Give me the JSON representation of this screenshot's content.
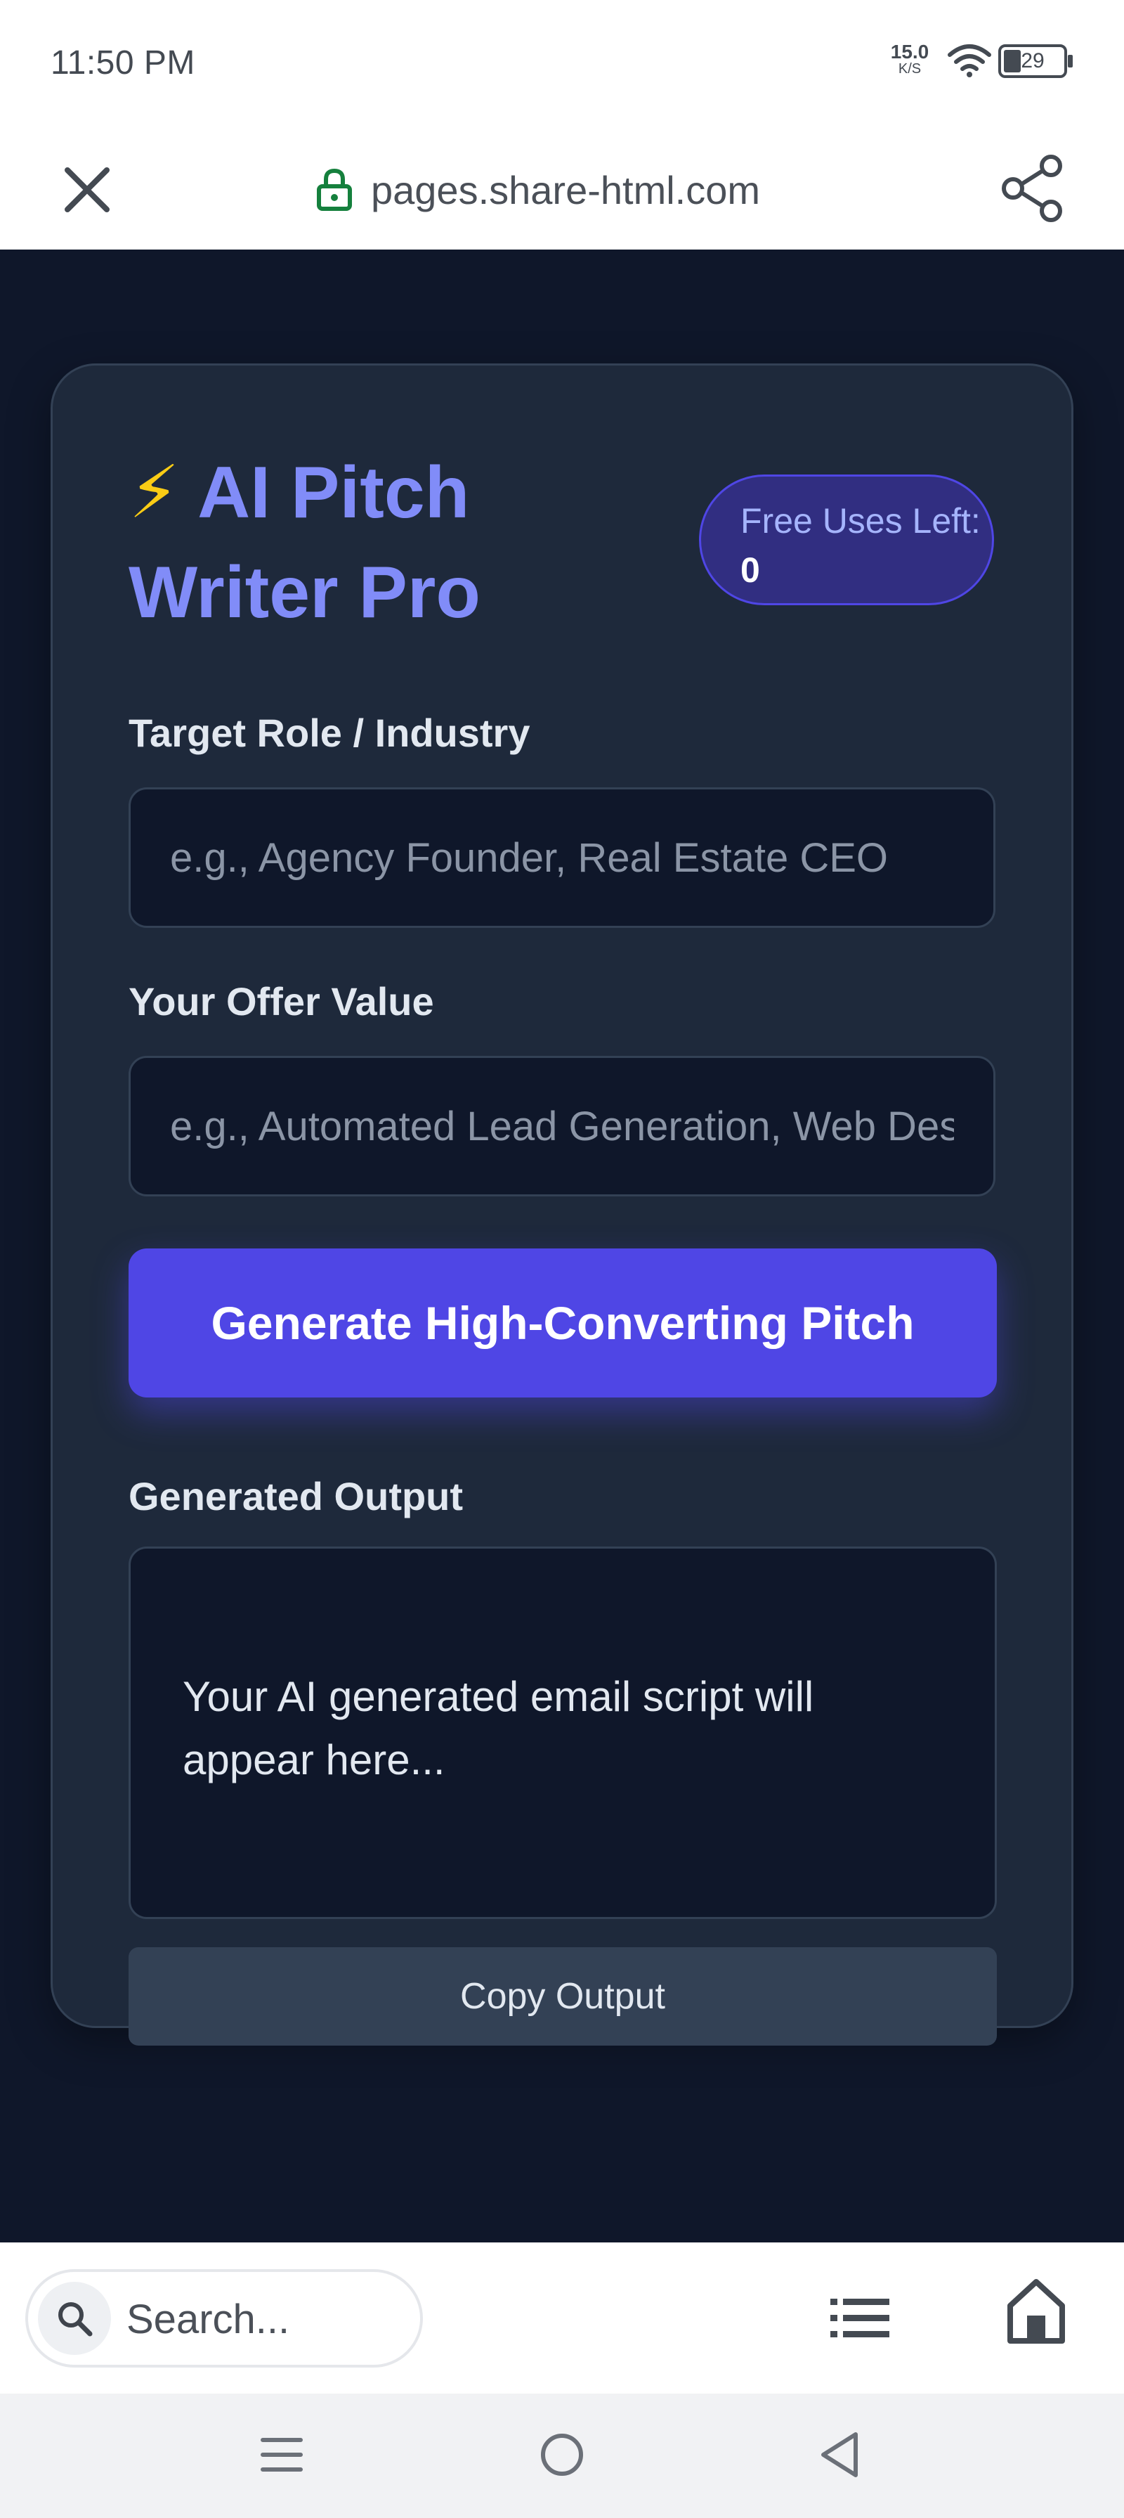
{
  "status_bar": {
    "time": "11:50 PM",
    "net_speed_value": "15.0",
    "net_speed_unit": "K/S",
    "battery_level": "29"
  },
  "browser": {
    "url": "pages.share-html.com"
  },
  "app": {
    "title_icon": "⚡",
    "title": "AI Pitch Writer Pro",
    "free_uses_label": "Free Uses Left:",
    "free_uses_count": "0",
    "target_label": "Target Role / Industry",
    "target_placeholder": "e.g., Agency Founder, Real Estate CEO",
    "offer_label": "Your Offer Value",
    "offer_placeholder": "e.g., Automated Lead Generation, Web Design",
    "generate_label": "Generate High-Converting Pitch",
    "output_label": "Generated Output",
    "output_placeholder": "Your AI generated email script will appear here...",
    "copy_label": "Copy Output"
  },
  "bottom_toolbar": {
    "search_placeholder": "Search..."
  },
  "colors": {
    "page_bg": "#0f172a",
    "card_bg": "#1e293b",
    "accent": "#4f46e5",
    "title": "#818cf8"
  }
}
